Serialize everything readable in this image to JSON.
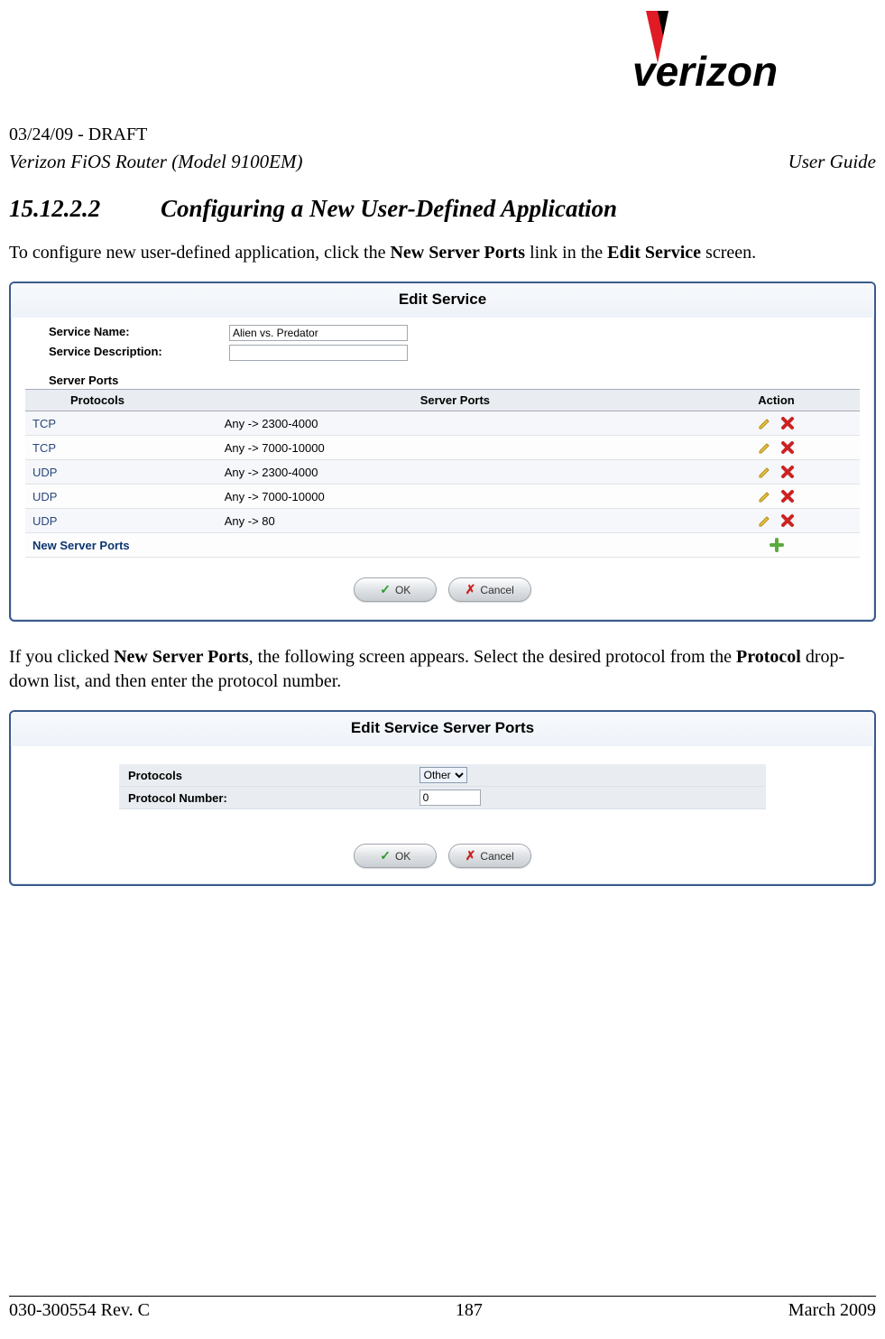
{
  "header": {
    "draft": "03/24/09 - DRAFT",
    "product": "Verizon FiOS Router (Model 9100EM)",
    "doc_type": "User Guide",
    "logo_text": "verizon"
  },
  "section": {
    "number": "15.12.2.2",
    "title": "Configuring a New User-Defined Application"
  },
  "intro1_a": "To configure new user-defined application, click the ",
  "intro1_b": "New Server Ports",
  "intro1_c": " link in the ",
  "intro1_d": "Edit Service",
  "intro1_e": " screen.",
  "panel1": {
    "title": "Edit Service",
    "service_name_label": "Service Name:",
    "service_name_value": "Alien vs. Predator",
    "service_desc_label": "Service Description:",
    "service_desc_value": "",
    "server_ports_heading": "Server Ports",
    "columns": {
      "protocols": "Protocols",
      "server_ports": "Server Ports",
      "action": "Action"
    },
    "rows": [
      {
        "protocol": "TCP",
        "ports": "Any -> 2300-4000"
      },
      {
        "protocol": "TCP",
        "ports": "Any -> 7000-10000"
      },
      {
        "protocol": "UDP",
        "ports": "Any -> 2300-4000"
      },
      {
        "protocol": "UDP",
        "ports": "Any -> 7000-10000"
      },
      {
        "protocol": "UDP",
        "ports": "Any -> 80"
      }
    ],
    "new_link": "New Server Ports",
    "ok": "OK",
    "cancel": "Cancel"
  },
  "intro2_a": "If you clicked ",
  "intro2_b": "New Server Ports",
  "intro2_c": ", the following screen appears. Select the desired protocol from the ",
  "intro2_d": "Protocol",
  "intro2_e": " drop-down list, and then enter the protocol number.",
  "panel2": {
    "title": "Edit Service Server Ports",
    "protocols_label": "Protocols",
    "protocols_value": "Other",
    "number_label": "Protocol Number:",
    "number_value": "0",
    "ok": "OK",
    "cancel": "Cancel"
  },
  "footer": {
    "left": "030-300554 Rev. C",
    "center": "187",
    "right": "March 2009"
  }
}
